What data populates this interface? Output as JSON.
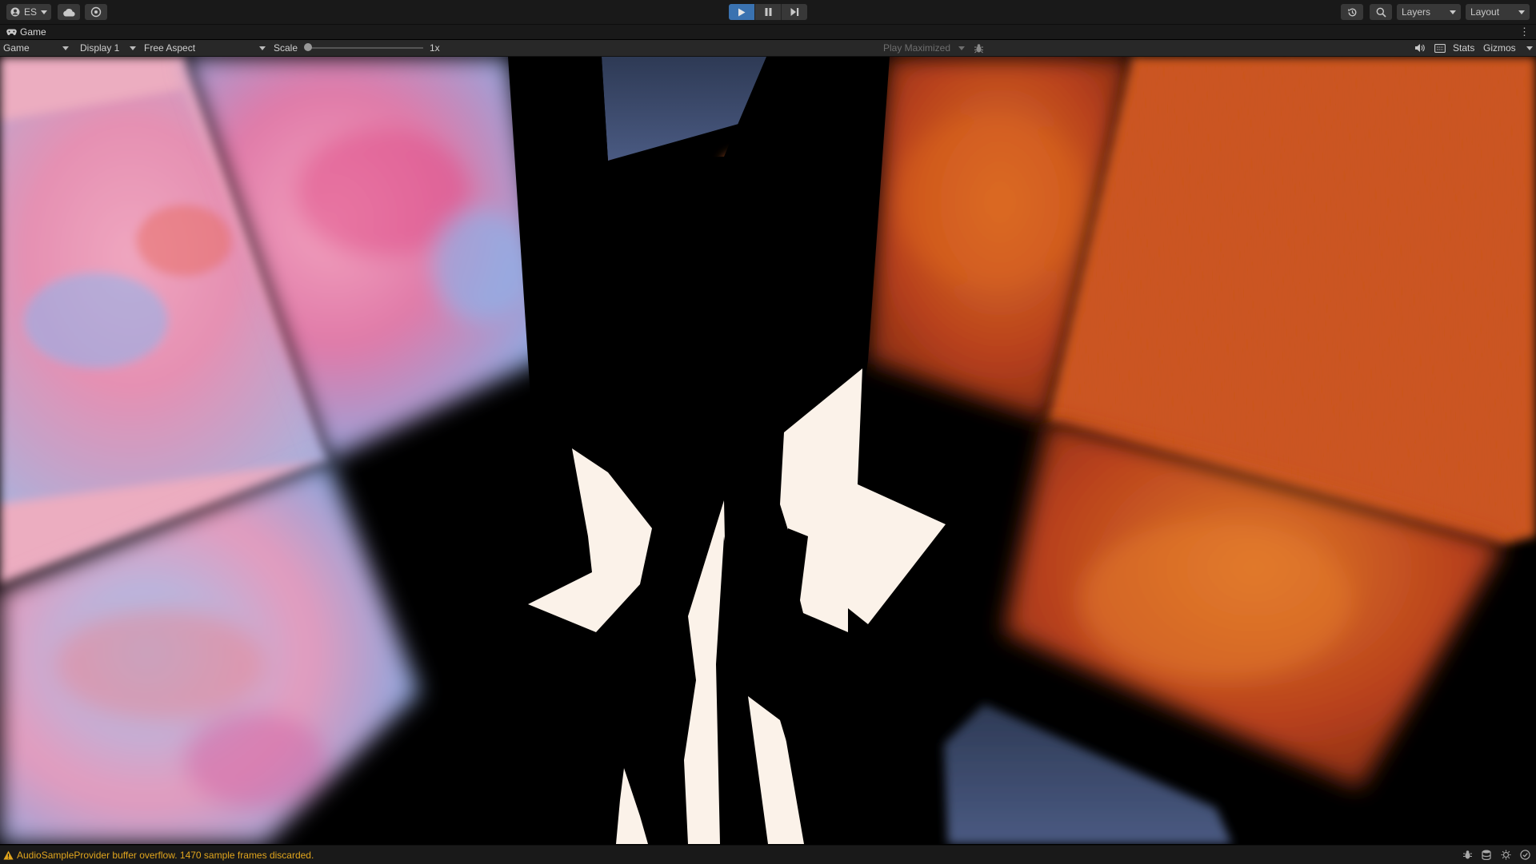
{
  "toolbar": {
    "account_label": "ES",
    "layers_label": "Layers",
    "layout_label": "Layout",
    "play_state": "playing"
  },
  "tabbar": {
    "tab_label": "Game"
  },
  "gamebar": {
    "view_label": "Game",
    "display_label": "Display 1",
    "aspect_label": "Free Aspect",
    "scale_label": "Scale",
    "scale_value": "1x",
    "scale_fraction": 0,
    "play_maximized_label": "Play Maximized",
    "stats_label": "Stats",
    "gizmos_label": "Gizmos"
  },
  "status": {
    "message": "AudioSampleProvider buffer overflow. 1470 sample frames discarded.",
    "message_color": "#e1a51d"
  },
  "colors": {
    "play_active": "#3a72b0",
    "toolbar_bg": "#191919",
    "gamebar_bg": "#282828"
  }
}
